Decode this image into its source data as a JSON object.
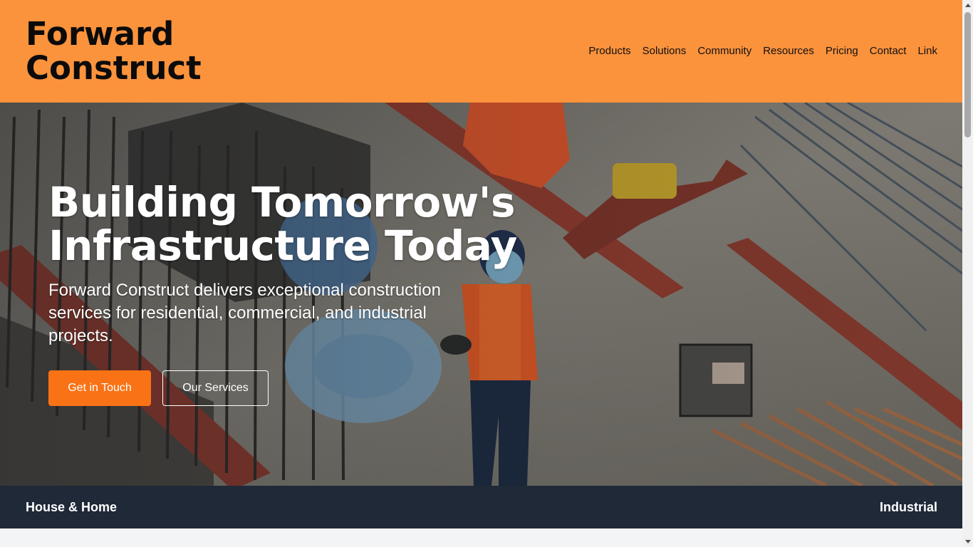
{
  "brand": {
    "name": "Forward Construct",
    "accent": "#fb923c",
    "button_color": "#f97316",
    "dark": "#1f2937"
  },
  "nav": {
    "items": [
      {
        "label": "Products"
      },
      {
        "label": "Solutions"
      },
      {
        "label": "Community"
      },
      {
        "label": "Resources"
      },
      {
        "label": "Pricing"
      },
      {
        "label": "Contact"
      },
      {
        "label": "Link"
      }
    ]
  },
  "hero": {
    "title": "Building Tomorrow's Infrastructure Today",
    "subtitle": "Forward Construct delivers exceptional construction services for residential, commercial, and industrial projects.",
    "primary_button": "Get in Touch",
    "secondary_button": "Our Services"
  },
  "categories": {
    "left": "House & Home",
    "right": "Industrial"
  },
  "icons": {
    "scroll_up": "caret-up-icon",
    "scroll_down": "caret-down-icon"
  }
}
